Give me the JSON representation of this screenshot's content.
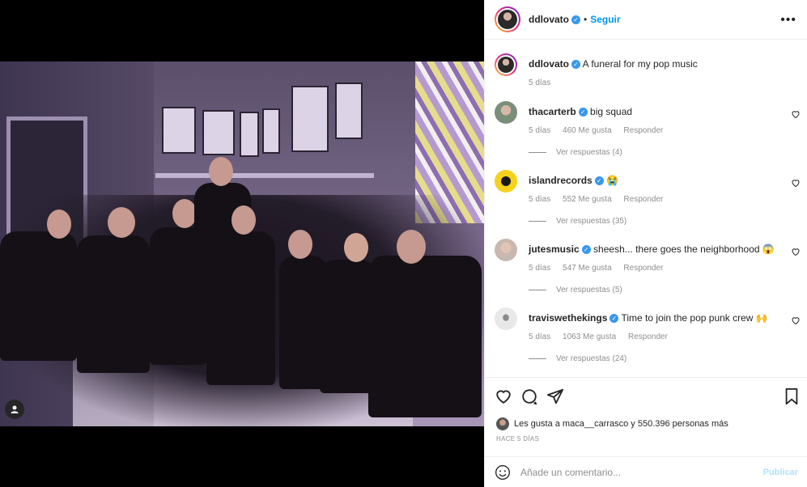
{
  "post": {
    "username": "ddlovato",
    "follow_label": "Seguir",
    "separator": "•",
    "more_label": "•••",
    "caption": "A funeral for my pop music",
    "caption_time": "5 días"
  },
  "comments": [
    {
      "user": "thacarterb",
      "text": "big squad",
      "time": "5 días",
      "likes": "460 Me gusta",
      "reply": "Responder",
      "replies": "Ver respuestas (4)",
      "avatar_color": "#7a8f7a"
    },
    {
      "user": "islandrecords",
      "text": "😭",
      "time": "5 días",
      "likes": "552 Me gusta",
      "reply": "Responder",
      "replies": "Ver respuestas (35)",
      "avatar_color": "#f7d21b"
    },
    {
      "user": "jutesmusic",
      "text": "sheesh... there goes the neighborhood 😱",
      "time": "5 días",
      "likes": "547 Me gusta",
      "reply": "Responder",
      "replies": "Ver respuestas (5)",
      "avatar_color": "#c9b8b0"
    },
    {
      "user": "traviswethekings",
      "text": "Time to join the pop punk crew 🙌",
      "time": "5 días",
      "likes": "1063 Me gusta",
      "reply": "Responder",
      "replies": "Ver respuestas (24)",
      "avatar_color": "#d9d9d9"
    }
  ],
  "footer": {
    "likes_text": "Les gusta a maca__carrasco y 550.396 personas más",
    "time_ago": "HACE 5 DÍAS",
    "comment_placeholder": "Añade un comentario...",
    "publish_label": "Publicar"
  },
  "colors": {
    "accent": "#0095f6",
    "verified": "#3897f0",
    "muted": "#8e8e8e"
  }
}
